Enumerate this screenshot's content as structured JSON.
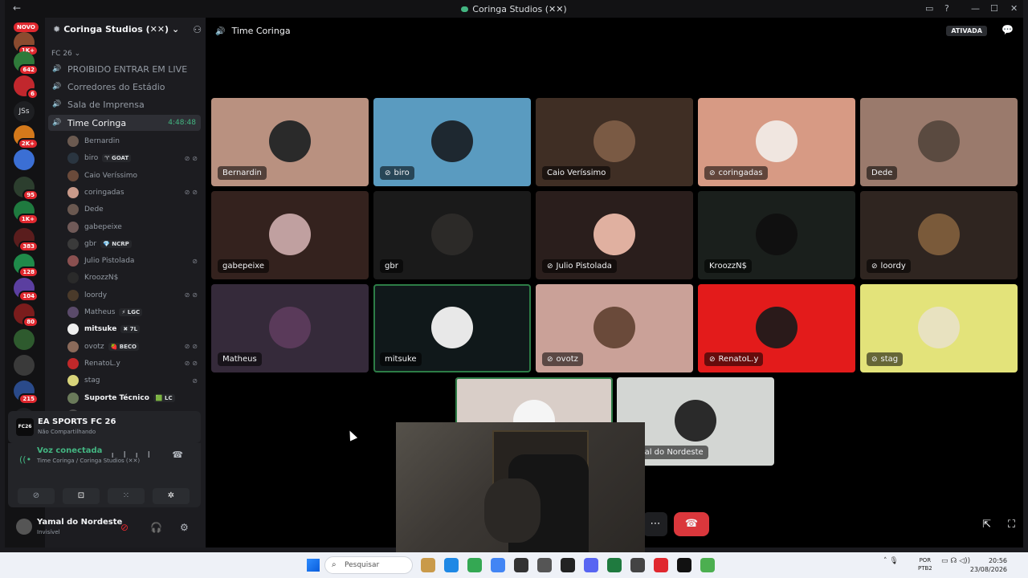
{
  "window": {
    "title": "Coringa Studios (✕✕)",
    "back": "←",
    "controls": [
      "▭",
      "?",
      "—",
      "☐",
      "✕"
    ]
  },
  "servers": {
    "novo_label": "NOVO",
    "items": [
      {
        "badge": "1K+",
        "color": "#8a4b2f"
      },
      {
        "badge": "642",
        "color": "#2f7a3a"
      },
      {
        "badge": "6",
        "color": "#c1272d"
      },
      {
        "badge": "",
        "color": "#1e1f22",
        "text": "JSs"
      },
      {
        "badge": "2K+",
        "color": "#d4791b"
      },
      {
        "badge": "",
        "color": "#3b6fd4"
      },
      {
        "badge": "95",
        "color": "#2c3e2e"
      },
      {
        "badge": "1K+",
        "color": "#1f7a3f"
      },
      {
        "badge": "383",
        "color": "#5a1d1d"
      },
      {
        "badge": "128",
        "color": "#1f8a4a"
      },
      {
        "badge": "104",
        "color": "#5b3fa0"
      },
      {
        "badge": "80",
        "color": "#7a1c1c"
      },
      {
        "badge": "",
        "color": "#2e5a2e"
      },
      {
        "badge": "",
        "color": "#3a3a3a"
      },
      {
        "badge": "215",
        "color": "#2a4a8a"
      }
    ],
    "add": "+"
  },
  "server_header": {
    "name": "Coringa Studios (✕✕)",
    "chevron": "⌄",
    "invite_icon": "person-add-icon"
  },
  "category": "FC 26 ⌄",
  "channels": [
    {
      "name": "PROIBIDO ENTRAR EM LIVE",
      "active": false
    },
    {
      "name": "Corredores do Estádio",
      "active": false
    },
    {
      "name": "Sala de Imprensa",
      "active": false
    },
    {
      "name": "Time Coringa",
      "active": true,
      "timer": "4:48:48"
    }
  ],
  "members": [
    {
      "name": "Bernardin",
      "tag": "",
      "status": "",
      "bright": false,
      "color": "#6b5a50"
    },
    {
      "name": "biro",
      "tag": "♈ GOAT",
      "status": "⊘⊘",
      "bright": false,
      "color": "#2a3540"
    },
    {
      "name": "Caio Veríssimo",
      "tag": "",
      "status": "",
      "bright": false,
      "color": "#6a4a3a"
    },
    {
      "name": "coringadas",
      "tag": "",
      "status": "⊘⊘",
      "bright": false,
      "color": "#c99a8a"
    },
    {
      "name": "Dede",
      "tag": "",
      "status": "",
      "bright": false,
      "color": "#6a5850"
    },
    {
      "name": "gabepeixe",
      "tag": "",
      "status": "",
      "bright": false,
      "color": "#705a58"
    },
    {
      "name": "gbr",
      "tag": "💎 NCRP",
      "status": "",
      "bright": false,
      "color": "#3a3a3a"
    },
    {
      "name": "Julio Pistolada",
      "tag": "",
      "status": "⊘",
      "bright": false,
      "color": "#8a5050"
    },
    {
      "name": "KroozzN$",
      "tag": "",
      "status": "",
      "bright": false,
      "color": "#2a2a2a"
    },
    {
      "name": "loordy",
      "tag": "",
      "status": "⊘⊘",
      "bright": false,
      "color": "#4a3a2a"
    },
    {
      "name": "Matheus",
      "tag": "⚡ LGC",
      "status": "",
      "bright": false,
      "color": "#5a4a6a"
    },
    {
      "name": "mitsuke",
      "tag": "✖ 7L",
      "status": "",
      "bright": true,
      "color": "#eeeeee"
    },
    {
      "name": "ovotz",
      "tag": "🍓 BECO",
      "status": "⊘⊘",
      "bright": false,
      "color": "#8a6a5a"
    },
    {
      "name": "RenatoL.y",
      "tag": "",
      "status": "⊘⊘",
      "bright": false,
      "color": "#c0282a"
    },
    {
      "name": "stag",
      "tag": "",
      "status": "⊘",
      "bright": false,
      "color": "#d8d47a"
    },
    {
      "name": "Suporte Técnico",
      "tag": "🟩 LC",
      "status": "",
      "bright": true,
      "color": "#6a7a5a"
    },
    {
      "name": "Yamal do Nordeste",
      "tag": "",
      "status": "⊘",
      "bright": false,
      "color": "#4a4a4a"
    }
  ],
  "activity": {
    "game_icon_text": "FC26",
    "game": "EA SPORTS FC 26",
    "sub": "Não Compartilhando"
  },
  "voice": {
    "status": "Voz conectada",
    "channel": "Time Coringa / Coringa Studios (✕✕)",
    "signal": "((•",
    "icons": "ılıl ☎"
  },
  "voice_buttons": [
    "⊘",
    "⊡",
    "⁙",
    "✲"
  ],
  "user": {
    "name": "Yamal do Nordeste",
    "status": "Invisível",
    "mic": "⊘",
    "headset": "🎧",
    "settings": "⚙"
  },
  "stage": {
    "channel_name": "Time Coringa",
    "badge": "ATIVADA",
    "chat_icon": "💬",
    "more": "⋯",
    "hangup": "☎",
    "popout": "⇱",
    "fullscreen": "⛶"
  },
  "tiles": [
    {
      "name": "Bernardin",
      "muted": false,
      "bg": "#b99180",
      "av": "#2a2a2a",
      "speaking": false
    },
    {
      "name": "biro",
      "muted": true,
      "bg": "#5a9bc0",
      "av": "#1e2830",
      "speaking": false
    },
    {
      "name": "Caio Veríssimo",
      "muted": false,
      "bg": "#3f2e24",
      "av": "#7a5a44",
      "speaking": false
    },
    {
      "name": "coringadas",
      "muted": true,
      "bg": "#d79a84",
      "av": "#f0e6e0",
      "speaking": false
    },
    {
      "name": "Dede",
      "muted": false,
      "bg": "#9a7a6c",
      "av": "#5a4a40",
      "speaking": false
    },
    {
      "name": "gabepeixe",
      "muted": false,
      "bg": "#34221e",
      "av": "#c0a0a0",
      "speaking": false
    },
    {
      "name": "gbr",
      "muted": false,
      "bg": "#1a1a1a",
      "av": "#2c2a28",
      "speaking": false
    },
    {
      "name": "Julio Pistolada",
      "muted": true,
      "bg": "#2a1e1c",
      "av": "#e0b0a0",
      "speaking": false
    },
    {
      "name": "KroozzN$",
      "muted": false,
      "bg": "#1a1f1c",
      "av": "#101010",
      "speaking": false
    },
    {
      "name": "loordy",
      "muted": true,
      "bg": "#2f2520",
      "av": "#7a5a3a",
      "speaking": false
    },
    {
      "name": "Matheus",
      "muted": false,
      "bg": "#352a3a",
      "av": "#5a3a5a",
      "speaking": false
    },
    {
      "name": "mitsuke",
      "muted": false,
      "bg": "#10181a",
      "av": "#e8e8e8",
      "speaking": true
    },
    {
      "name": "ovotz",
      "muted": true,
      "bg": "#caa198",
      "av": "#6a4a3a",
      "speaking": false
    },
    {
      "name": "RenatoL.y",
      "muted": true,
      "bg": "#e31b1b",
      "av": "#2a1a1a",
      "speaking": false
    },
    {
      "name": "stag",
      "muted": true,
      "bg": "#e3e37a",
      "av": "#e8e2c0",
      "speaking": false
    },
    {
      "name": "",
      "muted": false,
      "bg": "#d9cec8",
      "av": "#f5f5f5",
      "speaking": true
    },
    {
      "name": "Yamal do Nordeste",
      "muted": false,
      "bg": "#d3d6d3",
      "av": "#2a2a2a",
      "speaking": false
    }
  ],
  "taskbar": {
    "search_placeholder": "Pesquisar",
    "search_icon": "⌕",
    "apps": [
      "#c99a4a",
      "#1e88e5",
      "#34a853",
      "#4285f4",
      "#333",
      "#555",
      "#222",
      "#5865f2",
      "#1f7a3f",
      "#444",
      "#e0282f",
      "#111",
      "#4caf50"
    ],
    "tray": "˄  🎙  ",
    "lang": [
      "POR",
      "PTB2"
    ],
    "tray_icons": "▭ ☊ ◁))",
    "time": "20:56",
    "date": "23/08/2026"
  }
}
